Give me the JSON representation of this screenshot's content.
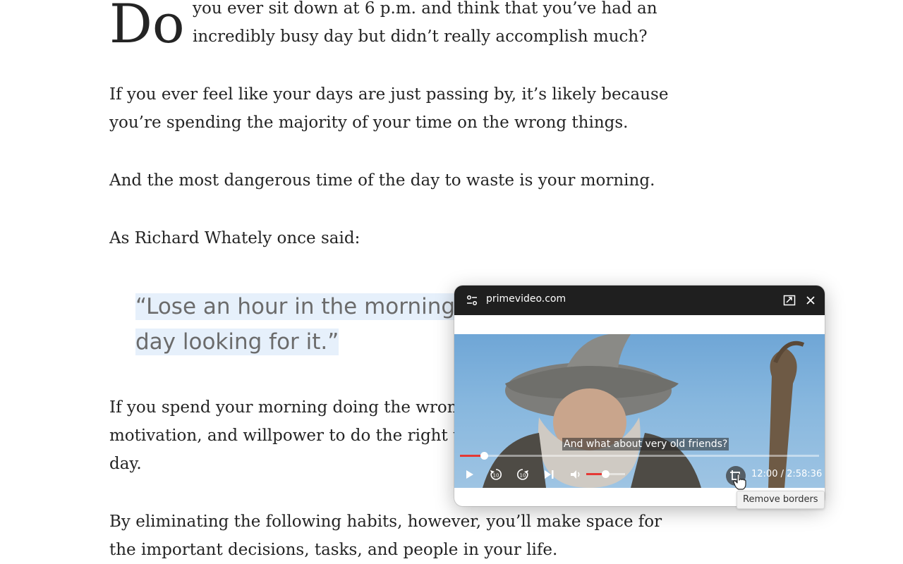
{
  "article": {
    "dropcap": "Do",
    "lead": "you ever sit down at 6 p.m. and think that you’ve had an incredibly busy day but didn’t really accomplish much?",
    "para1": "If you ever feel like your days are just passing by, it’s likely because you’re spending the majority of your time on the wrong things.",
    "para2": "And the most dangerous time of the day to waste is your morning.",
    "para3": "As Richard Whately once said:",
    "quote_line1": "“Lose an hour in the morning,",
    "quote_line2": "day looking for it.”",
    "para4_line1": "If you spend your morning doing the wrong",
    "para4_line2": "motivation, and willpower to do the right thi",
    "para4_line3": "day.",
    "para5": "By eliminating the following habits, however, you’ll make space for the important decisions, tasks, and people in your life."
  },
  "pip": {
    "site": "primevideo.com",
    "subtitle": "And what about very old friends?",
    "time": "12:00 / 2:58:36",
    "progress_fraction": 0.067,
    "volume_fraction": 0.5,
    "tooltip": "Remove borders",
    "icons": {
      "settings": "sliders-icon",
      "expand": "expand-icon",
      "close": "close-icon",
      "play": "play-icon",
      "rewind": "rewind-10-icon",
      "forward": "forward-10-icon",
      "next": "skip-next-icon",
      "volume": "volume-icon",
      "crop": "crop-icon"
    },
    "accent": "#e53935"
  }
}
